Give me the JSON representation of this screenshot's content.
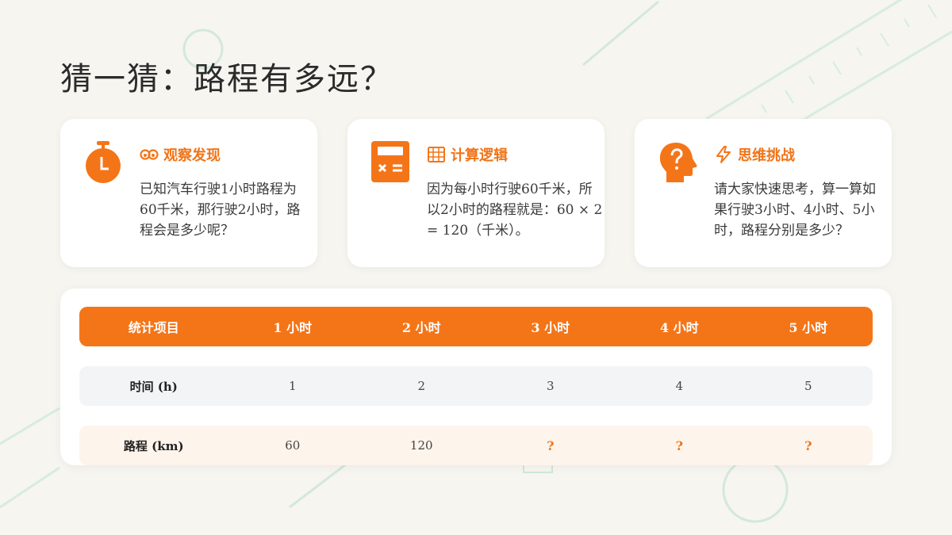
{
  "title": "猜一猜：路程有多远？",
  "colors": {
    "accent": "#f47518",
    "background": "#f6f5f0",
    "deco_green": "#cfe7d8"
  },
  "cards": [
    {
      "icon": "stopwatch-icon",
      "head_icon": "eyes-icon",
      "title": "观察发现",
      "text": "已知汽车行驶1小时路程为60千米，那行驶2小时，路程会是多少呢？"
    },
    {
      "icon": "calculator-icon",
      "head_icon": "abacus-icon",
      "title": "计算逻辑",
      "text": "因为每小时行驶60千米，所以2小时的路程就是：60 × 2 = 120（千米）。"
    },
    {
      "icon": "head-question-icon",
      "head_icon": "lightning-icon",
      "title": "思维挑战",
      "text": "请大家快速思考，算一算如果行驶3小时、4小时、5小时，路程分别是多少？"
    }
  ],
  "table": {
    "headers": [
      "统计项目",
      "1 小时",
      "2 小时",
      "3 小时",
      "4 小时",
      "5 小时"
    ],
    "rows": [
      {
        "label": "时间 (h)",
        "values": [
          "1",
          "2",
          "3",
          "4",
          "5"
        ]
      },
      {
        "label": "路程 (km)",
        "values": [
          "60",
          "120",
          "?",
          "?",
          "?"
        ]
      }
    ]
  }
}
